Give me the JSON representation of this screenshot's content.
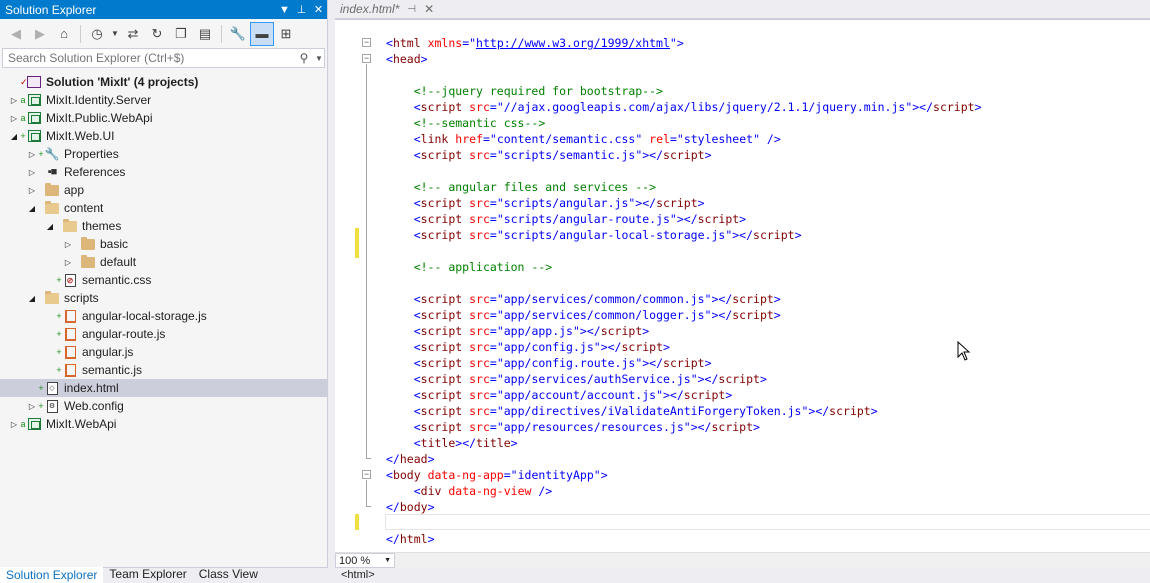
{
  "solution_explorer": {
    "title": "Solution Explorer",
    "search_placeholder": "Search Solution Explorer (Ctrl+$)",
    "tree": [
      {
        "label": "Solution 'MixIt' (4 projects)",
        "level": 0,
        "expander": "",
        "icon": "solution-icon",
        "bold": true,
        "mark": "✓"
      },
      {
        "label": "MixIt.Identity.Server",
        "level": 0,
        "expander": "collapsed",
        "icon": "project-icon",
        "mark": "a"
      },
      {
        "label": "MixIt.Public.WebApi",
        "level": 0,
        "expander": "collapsed",
        "icon": "project-icon",
        "mark": "a"
      },
      {
        "label": "MixIt.Web.UI",
        "level": 0,
        "expander": "expanded",
        "icon": "project-icon",
        "mark": "+"
      },
      {
        "label": "Properties",
        "level": 1,
        "expander": "collapsed",
        "icon": "wrench-icon",
        "mark": "+"
      },
      {
        "label": "References",
        "level": 1,
        "expander": "collapsed",
        "icon": "references-icon",
        "mark": ""
      },
      {
        "label": "app",
        "level": 1,
        "expander": "collapsed",
        "icon": "folder-icon",
        "mark": ""
      },
      {
        "label": "content",
        "level": 1,
        "expander": "expanded",
        "icon": "folder-open-icon",
        "mark": ""
      },
      {
        "label": "themes",
        "level": 2,
        "expander": "expanded",
        "icon": "folder-open-icon",
        "mark": ""
      },
      {
        "label": "basic",
        "level": 3,
        "expander": "collapsed",
        "icon": "folder-icon",
        "mark": ""
      },
      {
        "label": "default",
        "level": 3,
        "expander": "collapsed",
        "icon": "folder-icon",
        "mark": ""
      },
      {
        "label": "semantic.css",
        "level": 2,
        "expander": "",
        "icon": "css-file-icon",
        "mark": "+"
      },
      {
        "label": "scripts",
        "level": 1,
        "expander": "expanded",
        "icon": "folder-open-icon",
        "mark": ""
      },
      {
        "label": "angular-local-storage.js",
        "level": 2,
        "expander": "",
        "icon": "js-file-icon",
        "mark": "+"
      },
      {
        "label": "angular-route.js",
        "level": 2,
        "expander": "",
        "icon": "js-file-icon",
        "mark": "+"
      },
      {
        "label": "angular.js",
        "level": 2,
        "expander": "",
        "icon": "js-file-icon",
        "mark": "+"
      },
      {
        "label": "semantic.js",
        "level": 2,
        "expander": "",
        "icon": "js-file-icon",
        "mark": "+"
      },
      {
        "label": "index.html",
        "level": 1,
        "expander": "",
        "icon": "html-file-icon",
        "mark": "+",
        "selected": true
      },
      {
        "label": "Web.config",
        "level": 1,
        "expander": "collapsed",
        "icon": "config-file-icon",
        "mark": "+"
      },
      {
        "label": "MixIt.WebApi",
        "level": 0,
        "expander": "collapsed",
        "icon": "project-icon",
        "mark": "a"
      }
    ],
    "bottom_tabs": [
      "Solution Explorer",
      "Team Explorer",
      "Class View"
    ]
  },
  "editor": {
    "tab_label": "index.html*",
    "zoom": "100 %",
    "status_path": "<html>"
  },
  "code_lines": [
    [
      [
        "ang",
        "<"
      ],
      [
        "tg",
        "html"
      ],
      [
        "at",
        " xmlns"
      ],
      [
        "ang",
        "=\""
      ],
      [
        "url",
        "http://www.w3.org/1999/xhtml"
      ],
      [
        "ang",
        "\">"
      ]
    ],
    [
      [
        "ang",
        "<"
      ],
      [
        "tg",
        "head"
      ],
      [
        "ang",
        ">"
      ]
    ],
    [],
    [
      [
        "t",
        "    "
      ],
      [
        "cm",
        "<!--jquery required for bootstrap-->"
      ]
    ],
    [
      [
        "t",
        "    "
      ],
      [
        "ang",
        "<"
      ],
      [
        "tg",
        "script"
      ],
      [
        "at",
        " src"
      ],
      [
        "ang",
        "=\""
      ],
      [
        "av",
        "//ajax.googleapis.com/ajax/libs/jquery/2.1.1/jquery.min.js"
      ],
      [
        "ang",
        "\"></"
      ],
      [
        "tg",
        "script"
      ],
      [
        "ang",
        ">"
      ]
    ],
    [
      [
        "t",
        "    "
      ],
      [
        "cm",
        "<!--semantic css-->"
      ]
    ],
    [
      [
        "t",
        "    "
      ],
      [
        "ang",
        "<"
      ],
      [
        "tg",
        "link"
      ],
      [
        "at",
        " href"
      ],
      [
        "ang",
        "=\""
      ],
      [
        "av",
        "content/semantic.css"
      ],
      [
        "ang",
        "\""
      ],
      [
        "at",
        " rel"
      ],
      [
        "ang",
        "=\""
      ],
      [
        "av",
        "stylesheet"
      ],
      [
        "ang",
        "\" />"
      ]
    ],
    [
      [
        "t",
        "    "
      ],
      [
        "ang",
        "<"
      ],
      [
        "tg",
        "script"
      ],
      [
        "at",
        " src"
      ],
      [
        "ang",
        "=\""
      ],
      [
        "av",
        "scripts/semantic.js"
      ],
      [
        "ang",
        "\"></"
      ],
      [
        "tg",
        "script"
      ],
      [
        "ang",
        ">"
      ]
    ],
    [],
    [
      [
        "t",
        "    "
      ],
      [
        "cm",
        "<!-- angular files and services -->"
      ]
    ],
    [
      [
        "t",
        "    "
      ],
      [
        "ang",
        "<"
      ],
      [
        "tg",
        "script"
      ],
      [
        "at",
        " src"
      ],
      [
        "ang",
        "=\""
      ],
      [
        "av",
        "scripts/angular.js"
      ],
      [
        "ang",
        "\"></"
      ],
      [
        "tg",
        "script"
      ],
      [
        "ang",
        ">"
      ]
    ],
    [
      [
        "t",
        "    "
      ],
      [
        "ang",
        "<"
      ],
      [
        "tg",
        "script"
      ],
      [
        "at",
        " src"
      ],
      [
        "ang",
        "=\""
      ],
      [
        "av",
        "scripts/angular-route.js"
      ],
      [
        "ang",
        "\"></"
      ],
      [
        "tg",
        "script"
      ],
      [
        "ang",
        ">"
      ]
    ],
    [
      [
        "t",
        "    "
      ],
      [
        "ang",
        "<"
      ],
      [
        "tg",
        "script"
      ],
      [
        "at",
        " src"
      ],
      [
        "ang",
        "=\""
      ],
      [
        "av",
        "scripts/angular-local-storage.js"
      ],
      [
        "ang",
        "\"></"
      ],
      [
        "tg",
        "script"
      ],
      [
        "ang",
        ">"
      ]
    ],
    [],
    [
      [
        "t",
        "    "
      ],
      [
        "cm",
        "<!-- application -->"
      ]
    ],
    [],
    [
      [
        "t",
        "    "
      ],
      [
        "ang",
        "<"
      ],
      [
        "tg",
        "script"
      ],
      [
        "at",
        " src"
      ],
      [
        "ang",
        "=\""
      ],
      [
        "av",
        "app/services/common/common.js"
      ],
      [
        "ang",
        "\"></"
      ],
      [
        "tg",
        "script"
      ],
      [
        "ang",
        ">"
      ]
    ],
    [
      [
        "t",
        "    "
      ],
      [
        "ang",
        "<"
      ],
      [
        "tg",
        "script"
      ],
      [
        "at",
        " src"
      ],
      [
        "ang",
        "=\""
      ],
      [
        "av",
        "app/services/common/logger.js"
      ],
      [
        "ang",
        "\"></"
      ],
      [
        "tg",
        "script"
      ],
      [
        "ang",
        ">"
      ]
    ],
    [
      [
        "t",
        "    "
      ],
      [
        "ang",
        "<"
      ],
      [
        "tg",
        "script"
      ],
      [
        "at",
        " src"
      ],
      [
        "ang",
        "=\""
      ],
      [
        "av",
        "app/app.js"
      ],
      [
        "ang",
        "\"></"
      ],
      [
        "tg",
        "script"
      ],
      [
        "ang",
        ">"
      ]
    ],
    [
      [
        "t",
        "    "
      ],
      [
        "ang",
        "<"
      ],
      [
        "tg",
        "script"
      ],
      [
        "at",
        " src"
      ],
      [
        "ang",
        "=\""
      ],
      [
        "av",
        "app/config.js"
      ],
      [
        "ang",
        "\"></"
      ],
      [
        "tg",
        "script"
      ],
      [
        "ang",
        ">"
      ]
    ],
    [
      [
        "t",
        "    "
      ],
      [
        "ang",
        "<"
      ],
      [
        "tg",
        "script"
      ],
      [
        "at",
        " src"
      ],
      [
        "ang",
        "=\""
      ],
      [
        "av",
        "app/config.route.js"
      ],
      [
        "ang",
        "\"></"
      ],
      [
        "tg",
        "script"
      ],
      [
        "ang",
        ">"
      ]
    ],
    [
      [
        "t",
        "    "
      ],
      [
        "ang",
        "<"
      ],
      [
        "tg",
        "script"
      ],
      [
        "at",
        " src"
      ],
      [
        "ang",
        "=\""
      ],
      [
        "av",
        "app/services/authService.js"
      ],
      [
        "ang",
        "\"></"
      ],
      [
        "tg",
        "script"
      ],
      [
        "ang",
        ">"
      ]
    ],
    [
      [
        "t",
        "    "
      ],
      [
        "ang",
        "<"
      ],
      [
        "tg",
        "script"
      ],
      [
        "at",
        " src"
      ],
      [
        "ang",
        "=\""
      ],
      [
        "av",
        "app/account/account.js"
      ],
      [
        "ang",
        "\"></"
      ],
      [
        "tg",
        "script"
      ],
      [
        "ang",
        ">"
      ]
    ],
    [
      [
        "t",
        "    "
      ],
      [
        "ang",
        "<"
      ],
      [
        "tg",
        "script"
      ],
      [
        "at",
        " src"
      ],
      [
        "ang",
        "=\""
      ],
      [
        "av",
        "app/directives/iValidateAntiForgeryToken.js"
      ],
      [
        "ang",
        "\"></"
      ],
      [
        "tg",
        "script"
      ],
      [
        "ang",
        ">"
      ]
    ],
    [
      [
        "t",
        "    "
      ],
      [
        "ang",
        "<"
      ],
      [
        "tg",
        "script"
      ],
      [
        "at",
        " src"
      ],
      [
        "ang",
        "=\""
      ],
      [
        "av",
        "app/resources/resources.js"
      ],
      [
        "ang",
        "\"></"
      ],
      [
        "tg",
        "script"
      ],
      [
        "ang",
        ">"
      ]
    ],
    [
      [
        "t",
        "    "
      ],
      [
        "ang",
        "<"
      ],
      [
        "tg",
        "title"
      ],
      [
        "ang",
        "></"
      ],
      [
        "tg",
        "title"
      ],
      [
        "ang",
        ">"
      ]
    ],
    [
      [
        "ang",
        "</"
      ],
      [
        "tg",
        "head"
      ],
      [
        "ang",
        ">"
      ]
    ],
    [
      [
        "ang",
        "<"
      ],
      [
        "tg",
        "body"
      ],
      [
        "at",
        " data-ng-app"
      ],
      [
        "ang",
        "=\""
      ],
      [
        "av",
        "identityApp"
      ],
      [
        "ang",
        "\">"
      ]
    ],
    [
      [
        "t",
        "    "
      ],
      [
        "ang",
        "<"
      ],
      [
        "tg",
        "div"
      ],
      [
        "at",
        " data-ng-view"
      ],
      [
        "ang",
        " />"
      ]
    ],
    [
      [
        "ang",
        "</"
      ],
      [
        "tg",
        "body"
      ],
      [
        "ang",
        ">"
      ]
    ],
    [],
    [
      [
        "ang",
        "</"
      ],
      [
        "tg",
        "html"
      ],
      [
        "ang",
        ">"
      ]
    ]
  ]
}
